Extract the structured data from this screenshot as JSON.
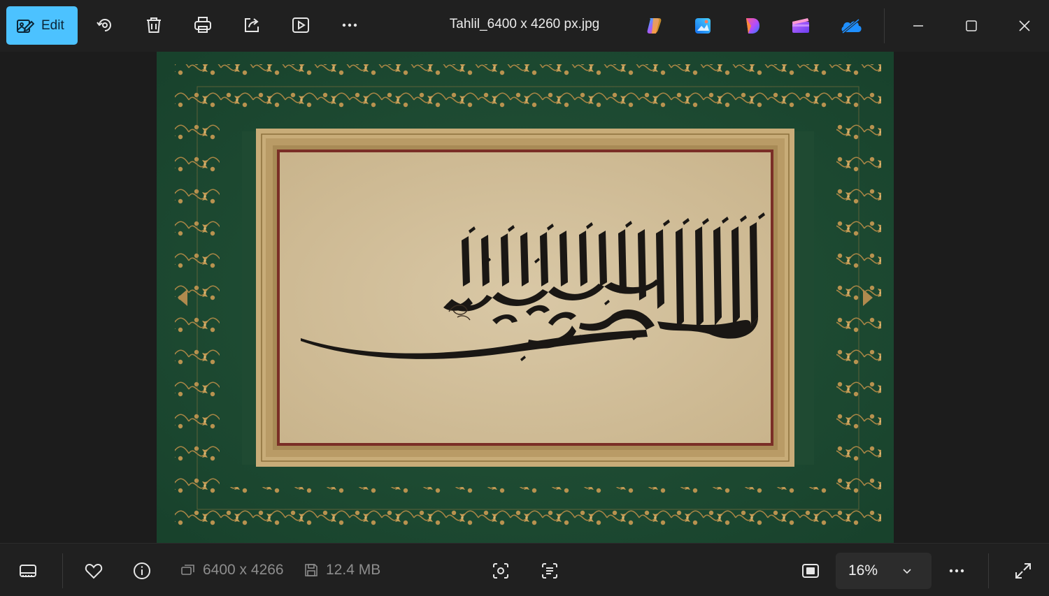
{
  "toolbar": {
    "edit_label": "Edit",
    "icons": [
      "rotate-icon",
      "delete-icon",
      "print-icon",
      "share-icon",
      "slideshow-icon",
      "more-icon"
    ]
  },
  "window": {
    "title": "Tahlil_6400 x 4260 px.jpg"
  },
  "app_icons": [
    "copilot-icon",
    "designer-icon",
    "clipchamp-icon",
    "video-editor-icon",
    "onedrive-icon"
  ],
  "status": {
    "dimensions": "6400 x 4266",
    "file_size": "12.4 MB",
    "zoom": "16%"
  },
  "colors": {
    "accent": "#4cc2ff",
    "frame_green": "#1f4a36",
    "paper": "#d4c2a0",
    "gold": "#b08a4e"
  }
}
